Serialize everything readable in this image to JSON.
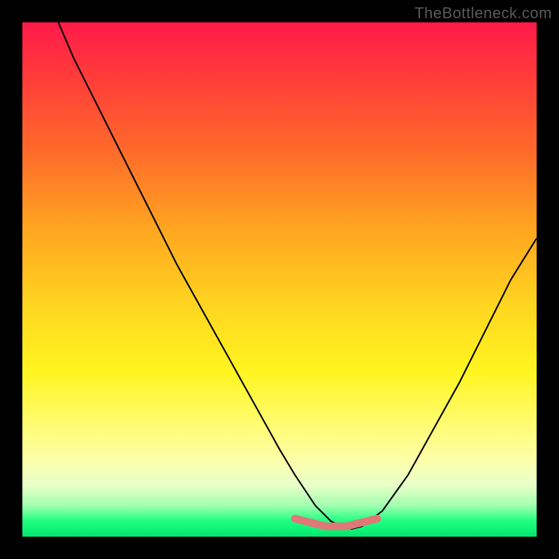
{
  "watermark": "TheBottleneck.com",
  "chart_data": {
    "type": "line",
    "title": "",
    "xlabel": "",
    "ylabel": "",
    "xlim": [
      0,
      100
    ],
    "ylim": [
      0,
      100
    ],
    "grid": false,
    "series": [
      {
        "name": "curve-black",
        "color": "#000000",
        "x": [
          7,
          10,
          15,
          20,
          25,
          30,
          35,
          40,
          45,
          50,
          53,
          55,
          57,
          60,
          62,
          64,
          66,
          70,
          75,
          80,
          85,
          90,
          95,
          100
        ],
        "y": [
          100,
          93,
          83,
          73,
          63,
          53,
          44,
          35,
          26,
          17,
          12,
          9,
          6,
          3,
          2,
          1.5,
          2,
          5,
          12,
          21,
          30,
          40,
          50,
          58
        ]
      },
      {
        "name": "highlight-pink",
        "color": "#e07878",
        "x": [
          53,
          55,
          57,
          59,
          61,
          63,
          65,
          67,
          69
        ],
        "y": [
          3.5,
          3,
          2.5,
          2,
          2,
          2,
          2.5,
          3,
          3.5
        ]
      }
    ],
    "background_gradient": {
      "type": "vertical",
      "stops": [
        {
          "pos": 0,
          "color": "#ff1a4a"
        },
        {
          "pos": 0.25,
          "color": "#ff6a2a"
        },
        {
          "pos": 0.55,
          "color": "#ffd520"
        },
        {
          "pos": 0.78,
          "color": "#fffc70"
        },
        {
          "pos": 0.94,
          "color": "#a0ffb0"
        },
        {
          "pos": 1.0,
          "color": "#00e870"
        }
      ]
    }
  }
}
